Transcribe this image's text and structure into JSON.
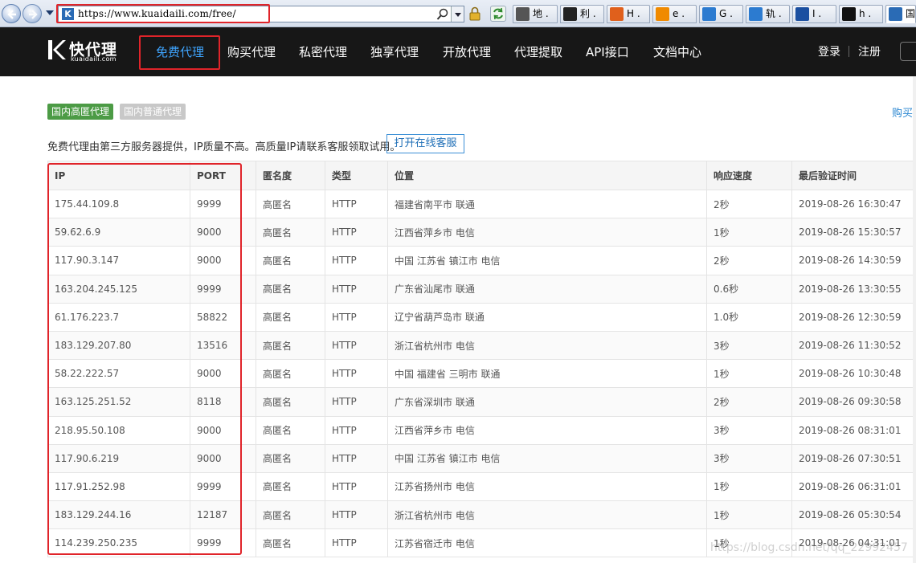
{
  "browser": {
    "url": "https://www.kuaidaili.com/free/",
    "tabs": [
      {
        "label": "地 .",
        "icon": "camera-icon",
        "color": "#555555"
      },
      {
        "label": "利 .",
        "icon": "dark-app-icon",
        "color": "#222222"
      },
      {
        "label": "H .",
        "icon": "ring-icon",
        "color": "#e0601c"
      },
      {
        "label": "e .",
        "icon": "orange-x-icon",
        "color": "#f08a00"
      },
      {
        "label": "G .",
        "icon": "ie-icon",
        "color": "#2c7bd0"
      },
      {
        "label": "轨 .",
        "icon": "ie-icon",
        "color": "#2c7bd0"
      },
      {
        "label": "I .",
        "icon": "blue-diamond-icon",
        "color": "#1b4fa0"
      },
      {
        "label": "h .",
        "icon": "black-square-icon",
        "color": "#111111"
      },
      {
        "label": "国",
        "icon": "kuaidaili-icon",
        "color": "#2a6bb5"
      }
    ]
  },
  "site": {
    "logo_cn": "快代理",
    "logo_en": "kuaidaili.com",
    "nav": [
      "免费代理",
      "购买代理",
      "私密代理",
      "独享代理",
      "开放代理",
      "代理提取",
      "API接口",
      "文档中心"
    ],
    "login": "登录",
    "register": "注册"
  },
  "filters": {
    "tag_high": "国内高匿代理",
    "tag_normal": "国内普通代理",
    "buy_link": "购买"
  },
  "notice": {
    "text": "免费代理由第三方服务器提供，IP质量不高。高质量IP请联系客服领取试用。",
    "button": "打开在线客服"
  },
  "table": {
    "headers": [
      "IP",
      "PORT",
      "匿名度",
      "类型",
      "位置",
      "响应速度",
      "最后验证时间"
    ],
    "rows": [
      [
        "175.44.109.8",
        "9999",
        "高匿名",
        "HTTP",
        "福建省南平市 联通",
        "2秒",
        "2019-08-26 16:30:47"
      ],
      [
        "59.62.6.9",
        "9000",
        "高匿名",
        "HTTP",
        "江西省萍乡市 电信",
        "1秒",
        "2019-08-26 15:30:57"
      ],
      [
        "117.90.3.147",
        "9000",
        "高匿名",
        "HTTP",
        "中国 江苏省 镇江市 电信",
        "2秒",
        "2019-08-26 14:30:59"
      ],
      [
        "163.204.245.125",
        "9999",
        "高匿名",
        "HTTP",
        "广东省汕尾市 联通",
        "0.6秒",
        "2019-08-26 13:30:55"
      ],
      [
        "61.176.223.7",
        "58822",
        "高匿名",
        "HTTP",
        "辽宁省葫芦岛市 联通",
        "1.0秒",
        "2019-08-26 12:30:59"
      ],
      [
        "183.129.207.80",
        "13516",
        "高匿名",
        "HTTP",
        "浙江省杭州市 电信",
        "3秒",
        "2019-08-26 11:30:52"
      ],
      [
        "58.22.222.57",
        "9000",
        "高匿名",
        "HTTP",
        "中国 福建省 三明市 联通",
        "1秒",
        "2019-08-26 10:30:48"
      ],
      [
        "163.125.251.52",
        "8118",
        "高匿名",
        "HTTP",
        "广东省深圳市 联通",
        "2秒",
        "2019-08-26 09:30:58"
      ],
      [
        "218.95.50.108",
        "9000",
        "高匿名",
        "HTTP",
        "江西省萍乡市 电信",
        "3秒",
        "2019-08-26 08:31:01"
      ],
      [
        "117.90.6.219",
        "9000",
        "高匿名",
        "HTTP",
        "中国 江苏省 镇江市 电信",
        "3秒",
        "2019-08-26 07:30:51"
      ],
      [
        "117.91.252.98",
        "9999",
        "高匿名",
        "HTTP",
        "江苏省扬州市 电信",
        "1秒",
        "2019-08-26 06:31:01"
      ],
      [
        "183.129.244.16",
        "12187",
        "高匿名",
        "HTTP",
        "浙江省杭州市 电信",
        "1秒",
        "2019-08-26 05:30:54"
      ],
      [
        "114.239.250.235",
        "9999",
        "高匿名",
        "HTTP",
        "江苏省宿迁市 电信",
        "1秒",
        "2019-08-26 04:31:01"
      ]
    ]
  },
  "watermark": "https://blog.csdn.net/qq_22992457",
  "colors": {
    "nav_bg": "#171717",
    "nav_active": "#3fa5ff",
    "highlight_red": "#e0242a",
    "tag_green": "#4c9b45",
    "tag_gray": "#c8c8c8"
  }
}
